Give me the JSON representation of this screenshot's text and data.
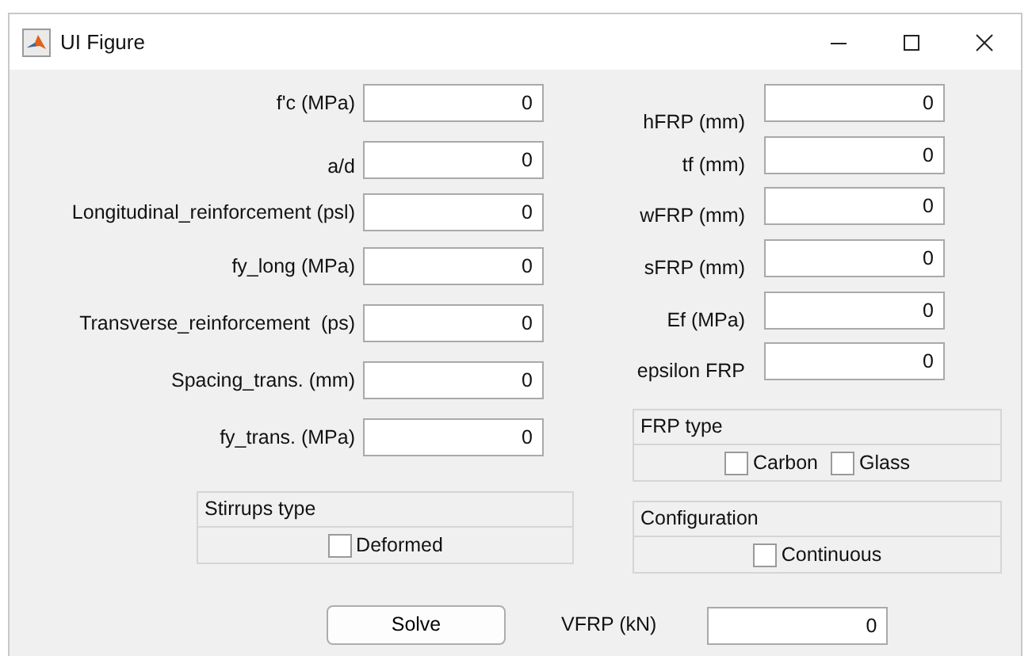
{
  "window": {
    "title": "UI Figure"
  },
  "left_fields": [
    {
      "label": "f'c (MPa)",
      "value": "0"
    },
    {
      "label": "a/d",
      "value": "0"
    },
    {
      "label": "Longitudinal_reinforcement (psl)",
      "value": "0"
    },
    {
      "label": "fy_long (MPa)",
      "value": "0"
    },
    {
      "label": "Transverse_reinforcement  (ps)",
      "value": "0"
    },
    {
      "label": "Spacing_trans. (mm)",
      "value": "0"
    },
    {
      "label": "fy_trans. (MPa)",
      "value": "0"
    }
  ],
  "right_fields": [
    {
      "label": "hFRP (mm)",
      "value": "0"
    },
    {
      "label": "tf (mm)",
      "value": "0"
    },
    {
      "label": "wFRP (mm)",
      "value": "0"
    },
    {
      "label": "sFRP (mm)",
      "value": "0"
    },
    {
      "label": "Ef (MPa)",
      "value": "0"
    },
    {
      "label": "epsilon FRP",
      "value": "0"
    }
  ],
  "stirrups_type": {
    "title": "Stirrups type",
    "options": [
      {
        "label": "Deformed",
        "checked": false
      }
    ]
  },
  "frp_type": {
    "title": "FRP type",
    "options": [
      {
        "label": "Carbon",
        "checked": false
      },
      {
        "label": "Glass",
        "checked": false
      }
    ]
  },
  "configuration": {
    "title": "Configuration",
    "options": [
      {
        "label": "Continuous",
        "checked": false
      }
    ]
  },
  "solve_button": {
    "label": "Solve"
  },
  "result": {
    "label": "VFRP (kN)",
    "value": "0"
  }
}
